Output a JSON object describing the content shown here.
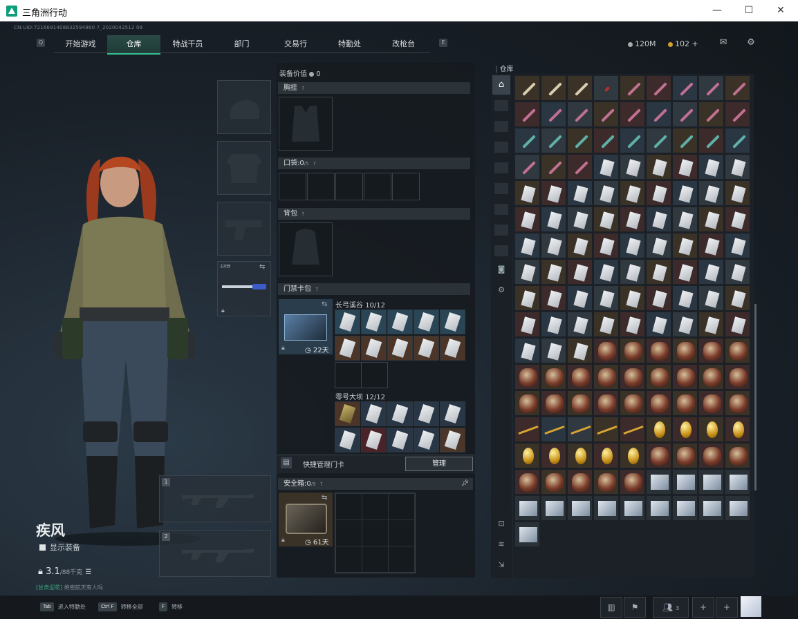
{
  "window": {
    "title": "三角洲行动",
    "minimize": "—",
    "maximize": "☐",
    "close": "✕"
  },
  "uid": "CN:UID:7216691408832594860 7_2020042512 09",
  "nav": {
    "left_key": "Q",
    "right_key": "E",
    "tabs": [
      "开始游戏",
      "仓库",
      "特战干员",
      "部门",
      "交易行",
      "特勤处",
      "改枪台"
    ],
    "active": 1
  },
  "currency": {
    "coins": "120M",
    "gold": "102",
    "plus": "+"
  },
  "character": {
    "name": "疾风",
    "show_gear": "显示装备",
    "weight_value": "3.1",
    "weight_max": "/88千克",
    "motto_prefix": "[甘肃迎花]",
    "motto_text": "绝密航天有人吗"
  },
  "left_slots": {
    "secondary_label": "主武器",
    "slot1_num": "1",
    "slot2_num": "2"
  },
  "equipment": {
    "value_label": "装备价值",
    "value": "0",
    "chest_rig": "胸挂",
    "pockets_label": "口袋:",
    "pockets_value": "0",
    "pockets_max": "/5",
    "backpack": "背包",
    "keycard_pack": "门禁卡包",
    "keycard_days": "22天",
    "dam1_label": "长弓溪谷",
    "dam1_value": "10/12",
    "dam2_label": "零号大坝",
    "dam2_value": "12/12",
    "quick_manage": "快捷管理门卡",
    "manage_button": "管理",
    "safebox_label": "安全箱:",
    "safebox_value": "0",
    "safebox_max": "/9",
    "safebox_days": "61天"
  },
  "warehouse": {
    "title": "仓库"
  },
  "bottom": {
    "hint1_key": "Tab",
    "hint1": "进入特勤处",
    "hint2_key": "Ctrl F",
    "hint2": "转移全部",
    "hint3_key": "F",
    "hint3": "转移",
    "friends_count": "3"
  },
  "colors": {
    "accent": "#2fbf8f",
    "gold": "#d4a12a"
  }
}
